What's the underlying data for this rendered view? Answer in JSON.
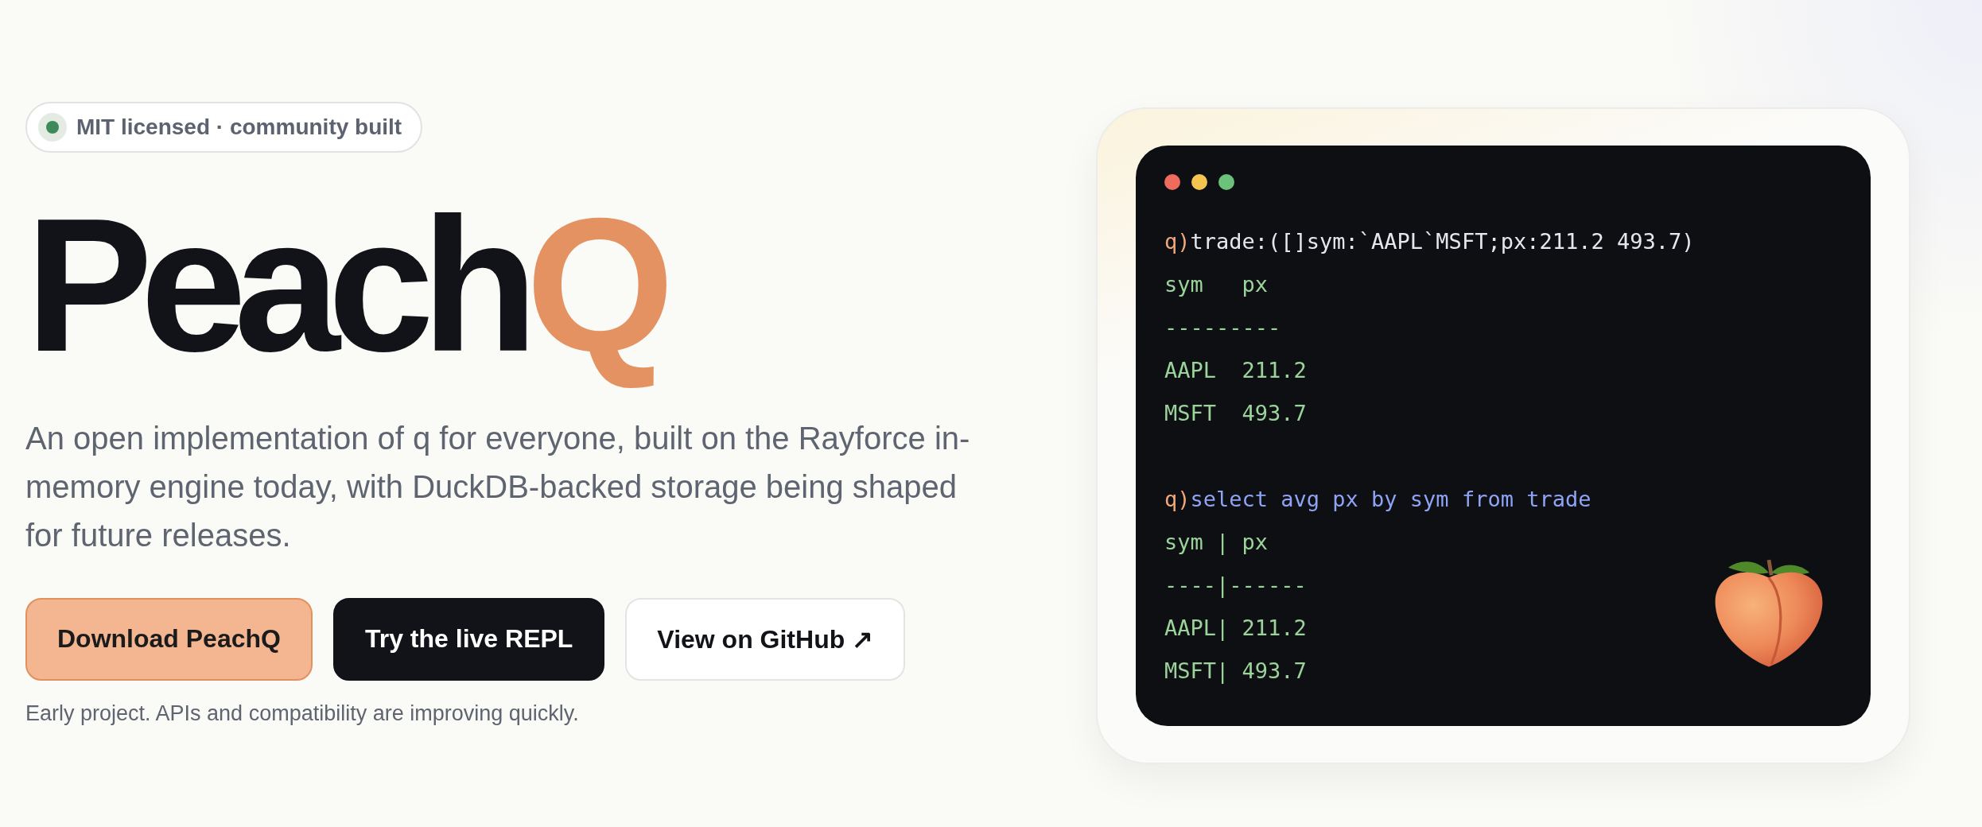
{
  "badge": {
    "text": "MIT licensed · community built",
    "color": "#3f8a5a"
  },
  "title": {
    "text": "Peach",
    "accent": "Q"
  },
  "description": "An open implementation of q for everyone, built on the Rayforce in-memory engine today, with DuckDB-backed storage being shaped for future releases.",
  "buttons": [
    {
      "label": "Download PeachQ",
      "kind": "primary"
    },
    {
      "label": "Try the live REPL",
      "kind": "dark"
    },
    {
      "label": "View on GitHub ↗",
      "kind": "outline"
    }
  ],
  "note": "Early project. APIs and compatibility are improving quickly.",
  "terminal": {
    "lines": [
      {
        "kind": "input",
        "prompt": "q)",
        "text": "trade:([]sym:`AAPL`MSFT;px:211.2 493.7)"
      },
      {
        "kind": "output",
        "text": "sym   px"
      },
      {
        "kind": "output",
        "text": "---------"
      },
      {
        "kind": "output",
        "text": "AAPL  211.2"
      },
      {
        "kind": "output",
        "text": "MSFT  493.7"
      },
      {
        "kind": "blank"
      },
      {
        "kind": "query",
        "prompt": "q)",
        "text": "select avg px by sym from trade"
      },
      {
        "kind": "output",
        "text": "sym | px"
      },
      {
        "kind": "output",
        "text": "----|------"
      },
      {
        "kind": "output",
        "text": "AAPL| 211.2"
      },
      {
        "kind": "output",
        "text": "MSFT| 493.7"
      }
    ]
  }
}
